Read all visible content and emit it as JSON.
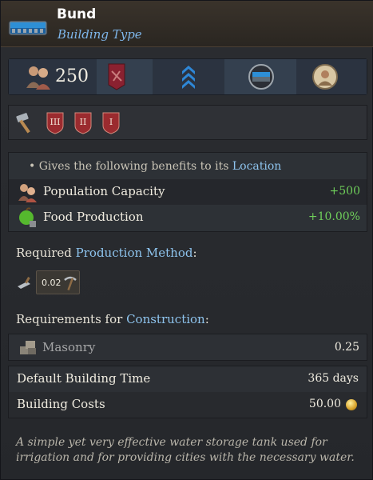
{
  "header": {
    "title": "Bund",
    "subtitle": "Building Type",
    "icon": "bund-building-icon"
  },
  "icon_bar": {
    "population": "250",
    "icons": [
      "population-icon",
      "banner-icon",
      "rank-chevrons-icon",
      "bund-icon",
      "portrait-icon"
    ]
  },
  "tiers": {
    "icons": [
      "hammer-icon"
    ],
    "labels": [
      "III",
      "II",
      "I"
    ]
  },
  "benefits": {
    "intro_prefix": "• Gives the following benefits to its ",
    "intro_link": "Location",
    "rows": [
      {
        "label": "Population Capacity",
        "value": "+500",
        "icon": "population-capacity-icon"
      },
      {
        "label": "Food Production",
        "value": "+10.00%",
        "icon": "food-production-icon"
      }
    ]
  },
  "production": {
    "title_prefix": "Required ",
    "title_link": "Production Method",
    "title_suffix": ":",
    "method_value": "0.02"
  },
  "construction": {
    "title_prefix": "Requirements for ",
    "title_link": "Construction",
    "title_suffix": ":",
    "material_label": "Masonry",
    "material_value": "0.25"
  },
  "costs": {
    "time_label": "Default Building Time",
    "time_value": "365 days",
    "cost_label": "Building Costs",
    "cost_value": "50.00"
  },
  "description": "A simple yet very effective water storage tank used for irrigation and for providing cities with the necessary water.",
  "colors": {
    "link": "#8ec4ee",
    "positive": "#6fcf5a",
    "subtitle": "#7eb6ea",
    "shield": "#9b2b2f"
  }
}
